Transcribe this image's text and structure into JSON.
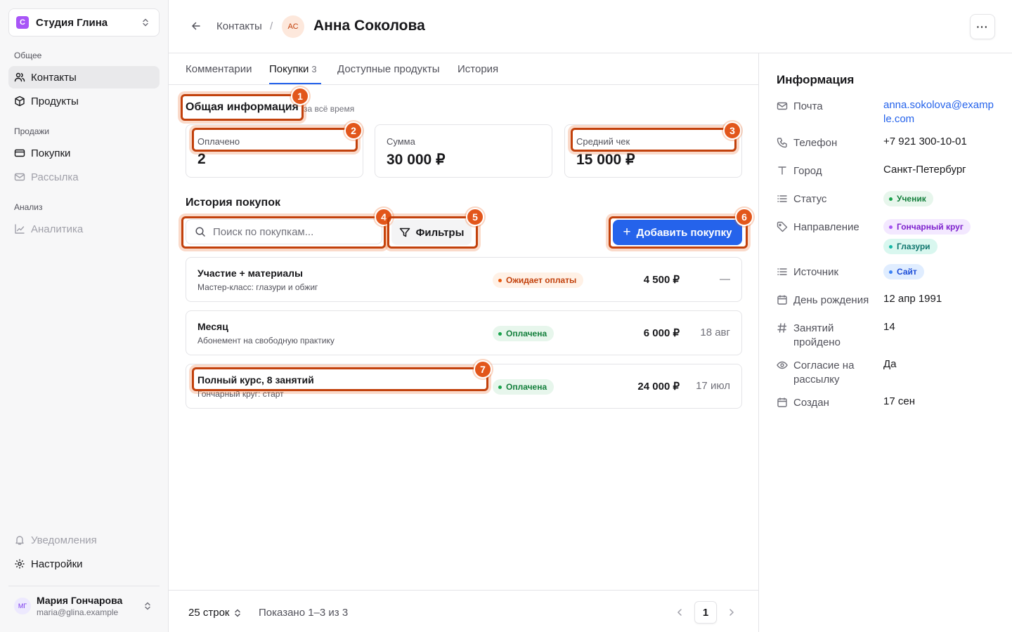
{
  "sidebar": {
    "workspace": {
      "initial": "С",
      "name": "Студия Глина"
    },
    "sections": [
      {
        "label": "Общее",
        "items": [
          {
            "label": "Контакты"
          },
          {
            "label": "Продукты"
          }
        ]
      },
      {
        "label": "Продажи",
        "items": [
          {
            "label": "Покупки"
          },
          {
            "label": "Рассылка"
          }
        ]
      },
      {
        "label": "Анализ",
        "items": [
          {
            "label": "Аналитика"
          }
        ]
      }
    ],
    "bottom": [
      {
        "label": "Уведомления"
      },
      {
        "label": "Настройки"
      }
    ],
    "user": {
      "initials": "МГ",
      "name": "Мария Гончарова",
      "email": "maria@glina.example"
    }
  },
  "header": {
    "breadcrumb": "Контакты",
    "separator": "/",
    "avatar_initials": "АС",
    "title": "Анна Соколова",
    "more_label": "···"
  },
  "tabs": [
    {
      "label": "Комментарии"
    },
    {
      "label": "Покупки",
      "count": "3"
    },
    {
      "label": "Доступные продукты"
    },
    {
      "label": "История"
    }
  ],
  "overview": {
    "title": "Общая информация",
    "subtitle": "за всё время",
    "cards": [
      {
        "label": "Оплачено",
        "value": "2"
      },
      {
        "label": "Сумма",
        "value": "30 000 ₽"
      },
      {
        "label": "Средний чек",
        "value": "15 000 ₽"
      }
    ]
  },
  "history": {
    "title": "История покупок",
    "search_placeholder": "Поиск по покупкам...",
    "filters_label": "Фильтры",
    "add_label": "Добавить покупку",
    "rows": [
      {
        "title": "Участие + материалы",
        "subtitle": "Мастер-класс: глазури и обжиг",
        "status": "Ожидает оплаты",
        "status_kind": "warning",
        "price": "4 500 ₽",
        "date": "—"
      },
      {
        "title": "Месяц",
        "subtitle": "Абонемент на свободную практику",
        "status": "Оплачена",
        "status_kind": "success",
        "price": "6 000 ₽",
        "date": "18 авг"
      },
      {
        "title": "Полный курс, 8 занятий",
        "subtitle": "Гончарный круг: старт",
        "status": "Оплачена",
        "status_kind": "success",
        "price": "24 000 ₽",
        "date": "17 июл"
      }
    ]
  },
  "footer": {
    "rows_per_page": "25 строк",
    "showing": "Показано 1–3 из 3",
    "current_page": "1"
  },
  "info": {
    "title": "Информация",
    "email": {
      "label": "Почта",
      "value": "anna.sokolova@example.com"
    },
    "phone": {
      "label": "Телефон",
      "value": "+7 921 300-10-01"
    },
    "city": {
      "label": "Город",
      "value": "Санкт-Петербург"
    },
    "status": {
      "label": "Статус",
      "value": "Ученик"
    },
    "direction": {
      "label": "Направление",
      "values": [
        "Гончарный круг",
        "Глазури"
      ]
    },
    "source": {
      "label": "Источник",
      "value": "Сайт"
    },
    "birthday": {
      "label": "День рождения",
      "value": "12 апр 1991"
    },
    "lessons": {
      "label": "Занятий пройдено",
      "value": "14"
    },
    "consent": {
      "label": "Согласие на рассылку",
      "value": "Да"
    },
    "created": {
      "label": "Создан",
      "value": "17 сен"
    }
  },
  "annotations": [
    "1",
    "2",
    "3",
    "4",
    "5",
    "6",
    "7"
  ],
  "colors": {
    "accent": "#2563eb",
    "annotation": "#e2561b"
  }
}
